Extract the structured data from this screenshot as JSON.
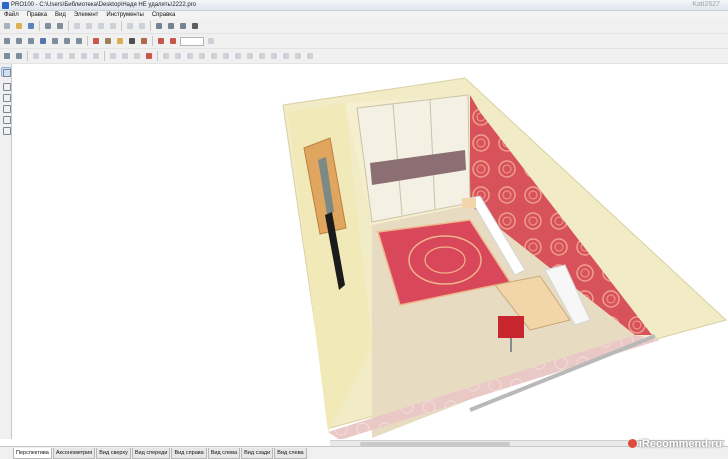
{
  "window": {
    "title": "PRO100 - C:\\Users\\Библиотека\\Desktop\\Надя НЕ удалять\\2222.pro",
    "corner_label": "Kati2627"
  },
  "menu": [
    "Файл",
    "Правка",
    "Вид",
    "Элемент",
    "Инструменты",
    "Справка"
  ],
  "toolbar_row1": [
    "new-icon",
    "open-icon",
    "save-icon",
    "print-icon",
    "print-preview-icon",
    "cut-icon",
    "copy-icon",
    "paste-icon",
    "delete-icon",
    "undo-icon",
    "redo-icon",
    "properties-icon",
    "catalog-icon",
    "library-icon",
    "sum-icon"
  ],
  "toolbar_row2": [
    "view-perspective-icon",
    "view-top-icon",
    "view-front-icon",
    "view-axon-icon",
    "view-right-icon",
    "view-left-icon",
    "view-back-icon",
    "wireframe-icon",
    "render-icon",
    "texture-icon",
    "light-icon",
    "camera-icon",
    "zoom-in-icon",
    "zoom-out-icon"
  ],
  "toolbar_row3": [
    "grid-icon",
    "snap-icon",
    "move-icon",
    "rotate-icon",
    "align-left-icon",
    "align-right-icon",
    "align-top-icon",
    "align-bottom-icon",
    "distribute-icon",
    "group-icon",
    "ungroup-icon",
    "lock-icon"
  ],
  "colors": {
    "wall": "#f2eac0",
    "floor": "#e8dcc0",
    "wallpaper": "#d8525c",
    "rug": "#d9475a",
    "wardrobe": "#f4f1e4"
  },
  "tabs": [
    {
      "label": "Перспектива",
      "active": true
    },
    {
      "label": "Аксонометрия",
      "active": false
    },
    {
      "label": "Вид сверху",
      "active": false
    },
    {
      "label": "Вид спереди",
      "active": false
    },
    {
      "label": "Вид справа",
      "active": false
    },
    {
      "label": "Вид слева",
      "active": false
    },
    {
      "label": "Вид сзади",
      "active": false
    },
    {
      "label": "Вид слева",
      "active": false
    }
  ],
  "watermark": "iRecommend.ru"
}
